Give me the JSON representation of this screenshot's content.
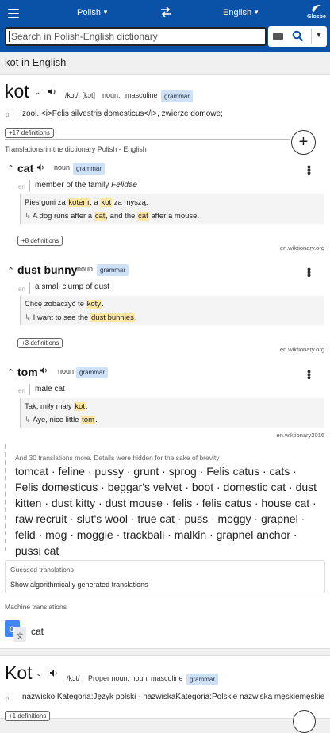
{
  "header": {
    "from_lang": "Polish",
    "to_lang": "English",
    "logo_text": "Glosbe",
    "search_placeholder": "Search in Polish-English dictionary",
    "brand_color": "#0a52a8"
  },
  "headline": "kot in English",
  "main_entry": {
    "word": "kot",
    "pronunciation": "/kɔt/, [kɔt]",
    "pos": "noun,",
    "gender": "masculine",
    "grammar_tag": "grammar",
    "pl_label": "pl",
    "definition": "zool. <i>Felis silvestris domesticus</i>, zwierzę domowe;",
    "more_definitions": "+17 definitions"
  },
  "translations_title": "Translations in the dictionary Polish - English",
  "translations": [
    {
      "word": "cat",
      "pos": "noun",
      "grammar_tag": "grammar",
      "lang": "en",
      "definition_prefix": "member of the family ",
      "definition_italic": "Felidae",
      "example_pl": [
        "Pies goni za ",
        "kotem",
        ", a ",
        "kot",
        " za myszą."
      ],
      "example_en": [
        "A dog runs after a ",
        "cat",
        ", and the ",
        "cat",
        " after a mouse."
      ],
      "more_definitions": "+8 definitions",
      "source": "en.wiktionary.org"
    },
    {
      "word": "dust bunny",
      "pos": "noun",
      "grammar_tag": "grammar",
      "lang": "en",
      "definition": "a small clump of dust",
      "example_pl": [
        "Chcę zobaczyć te ",
        "koty",
        "."
      ],
      "example_en": [
        "I want to see the ",
        "dust bunnies",
        "."
      ],
      "more_definitions": "+3 definitions",
      "source": "en.wiktionary.org"
    },
    {
      "word": "tom",
      "pos": "noun",
      "grammar_tag": "grammar",
      "lang": "en",
      "definition": "male cat",
      "example_pl": [
        "Tak, miły mały ",
        "kot",
        "."
      ],
      "example_en": [
        "Aye, nice little ",
        "tom",
        "."
      ],
      "source": "en.wiktionary2016"
    }
  ],
  "more_translations_note": "And 30 translations more. Details were hidden for the sake of brevity",
  "more_translations": "tomcat · feline · pussy · grunt · sprog · Felis catus · cats · Felis domesticus · beggar's velvet · boot · domestic cat · dust kitten · dust kitty · dust mouse · felis · felis catus · house cat · raw recruit · slut's wool · true cat · puss · moggy · grapnel · felid · mog · moggie · trackball · malkin · grapnel anchor · pussi cat",
  "guessed": {
    "title": "Guessed translations",
    "link": "Show algorithmically generated translations"
  },
  "machine": {
    "title": "Machine translations",
    "result": "cat"
  },
  "second_entry": {
    "word": "Kot",
    "pronunciation": "/kɔt/",
    "pos": "Proper noun, noun",
    "gender": "masculine",
    "grammar_tag": "grammar",
    "pl_label": "pl",
    "definition": "nazwisko Kategoria:Język polski - nazwiskaKategoria:Polskie nazwiska męskiemęskie",
    "more_definitions": "+1 definitions"
  }
}
